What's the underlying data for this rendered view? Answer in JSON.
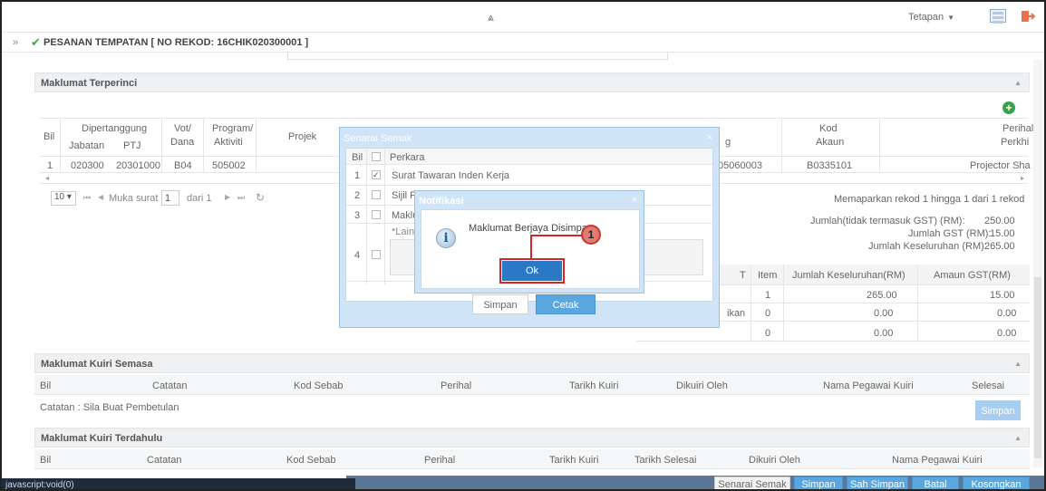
{
  "topbar": {
    "collapse_icon": "double-chevron-up-icon",
    "settings_label": "Tetapan",
    "settings_caret": "▼"
  },
  "title": {
    "collapse_icon": "double-chevron-right",
    "text": "PESANAN TEMPATAN [ NO REKOD: 16CHIK020300001 ]"
  },
  "detail": {
    "header": "Maklumat Terperinci",
    "headers": {
      "bil": "Bil",
      "dipertanggung": "Dipertanggung",
      "jabatan": "Jabatan",
      "ptj": "PTJ",
      "vot": "Vot/",
      "dana": "Dana",
      "program": "Program/",
      "aktiviti": "Aktiviti",
      "projek": "Projek",
      "kod": "Kod",
      "akaun": "Akaun",
      "perihal": "Perihal",
      "perkhidmatan": "Perkhi",
      "g": "g"
    },
    "row": {
      "bil": "1",
      "jabatan": "020300",
      "ptj": "20301000",
      "vot": "B04",
      "program": "505002",
      "kod_g": "05060003",
      "akaun": "B0335101",
      "perihal": "Projector Sha"
    },
    "pager": {
      "page_size": "10",
      "first": "⏮",
      "prev": "◀",
      "muka_surat": "Muka surat",
      "page": "1",
      "dari": "dari 1",
      "next": "▶",
      "last": "⏭",
      "refresh": "↻",
      "summary": "Memaparkan rekod 1 hingga 1 dari 1 rekod"
    },
    "totals": [
      {
        "label": "Jumlah(tidak termasuk GST) (RM):",
        "value": "250.00"
      },
      {
        "label": "Jumlah GST (RM):",
        "value": "15.00"
      },
      {
        "label": "Jumlah Keseluruhan (RM):",
        "value": "265.00"
      }
    ],
    "gst_table": {
      "headers": [
        "T",
        "Item",
        "Jumlah Keseluruhan(RM)",
        "Amaun GST(RM)"
      ],
      "rows": [
        {
          "a": "",
          "item": "1",
          "total": "265.00",
          "gst": "15.00"
        },
        {
          "a": "ikan",
          "item": "0",
          "total": "0.00",
          "gst": "0.00"
        },
        {
          "a": "",
          "item": "0",
          "total": "0.00",
          "gst": "0.00"
        }
      ]
    }
  },
  "kuiri_semasa": {
    "header": "Maklumat Kuiri Semasa",
    "columns": [
      "Bil",
      "Catatan",
      "Kod Sebab",
      "Perihal",
      "Tarikh Kuiri",
      "Dikuiri Oleh",
      "Nama Pegawai Kuiri",
      "Selesai"
    ],
    "note": "Catatan : Sila Buat Pembetulan",
    "save_label": "Simpan"
  },
  "kuiri_terdahulu": {
    "header": "Maklumat Kuiri Terdahulu",
    "columns": [
      "Bil",
      "Catatan",
      "Kod Sebab",
      "Perihal",
      "Tarikh Kuiri",
      "Tarikh Selesai",
      "Dikuiri Oleh",
      "Nama Pegawai Kuiri"
    ]
  },
  "semak_dialog": {
    "title": "Senarai Semak",
    "close": "×",
    "headers": {
      "bil": "Bil",
      "perkara": "Perkara"
    },
    "items": [
      {
        "bil": "1",
        "text": "Surat Tawaran Inden Kerja",
        "checked": true
      },
      {
        "bil": "2",
        "text": "Sijil P",
        "checked": false
      },
      {
        "bil": "3",
        "text": "Maklu",
        "checked": false
      },
      {
        "bil": "4",
        "text": "*Lain-",
        "checked": false
      }
    ],
    "save_label": "Simpan",
    "print_label": "Cetak"
  },
  "notif_dialog": {
    "title": "Notifikasi",
    "close": "×",
    "message": "Maklumat Berjaya Disimpan",
    "ok_label": "Ok",
    "info_glyph": "i"
  },
  "callout": {
    "number": "1"
  },
  "bottom_actions": [
    "Senarai Semak",
    "Simpan",
    "Sah Simpan",
    "Batal",
    "Kosongkan"
  ],
  "status_text": "javascript:void(0)",
  "colors": {
    "accent": "#5aa7e0",
    "ok_button": "#2a79c7",
    "highlight": "#d8232a",
    "check": "#4aa34a"
  }
}
